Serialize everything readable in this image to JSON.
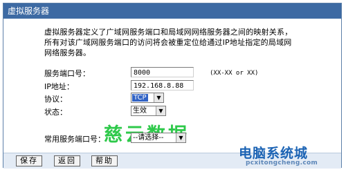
{
  "window": {
    "title": "虚拟服务器"
  },
  "description": {
    "line1": "虚拟服务器定义了广域网服务端口和局域网网络服务器之间的映射关系，",
    "line2": "所有对该广域网服务端口的访问将会被重定位给通过IP地址指定的局域网",
    "line3": "网络服务器。"
  },
  "form": {
    "service_port": {
      "label": "服务端口号：",
      "value": "8000",
      "hint": "(XX-XX or XX)"
    },
    "ip_address": {
      "label": "IP地址：",
      "value": "192.168.8.88"
    },
    "protocol": {
      "label": "协议：",
      "selected": "TCP"
    },
    "status": {
      "label": "状态：",
      "selected": "生效"
    },
    "common_port": {
      "label": "常用服务端口号：",
      "selected": "--请选择--"
    }
  },
  "buttons": {
    "save": "保存",
    "back": "返回",
    "help": "帮助"
  },
  "watermark": "慈云数据",
  "logo": {
    "name": "电脑系统城",
    "url": "pcxitongcheng.com"
  },
  "colors": {
    "titlebar": "#3d6aa3",
    "watermark": "#2ec94a",
    "logo": "#1b63b4"
  }
}
